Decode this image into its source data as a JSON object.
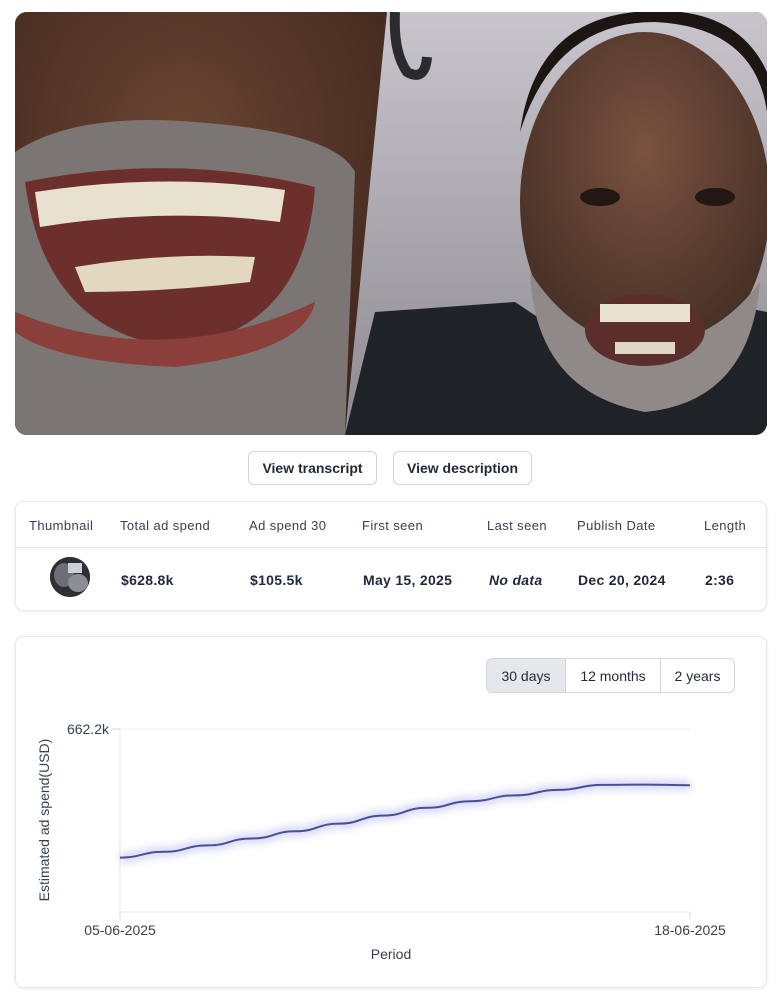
{
  "video": {
    "description_icon": "video-player"
  },
  "buttons": {
    "transcript": "View transcript",
    "description": "View description"
  },
  "stats": {
    "headers": [
      "Thumbnail",
      "Total ad spend",
      "Ad spend 30",
      "First seen",
      "Last seen",
      "Publish Date",
      "Length"
    ],
    "values": {
      "total_ad_spend": "$628.8k",
      "ad_spend_30": "$105.5k",
      "first_seen": "May 15, 2025",
      "last_seen": "No data",
      "publish_date": "Dec 20, 2024",
      "length": "2:36"
    }
  },
  "range": {
    "options": [
      "30 days",
      "12 months",
      "2 years"
    ],
    "selected": "30 days"
  },
  "chart_data": {
    "type": "line",
    "xlabel": "Period",
    "ylabel": "Estimated ad spend(USD)",
    "x_ticks": [
      "05-06-2025",
      "18-06-2025"
    ],
    "y_ticks": [
      "662.2k"
    ],
    "ylim": [
      0,
      662200
    ],
    "x": [
      "05-06-2025",
      "06-06-2025",
      "07-06-2025",
      "08-06-2025",
      "09-06-2025",
      "10-06-2025",
      "11-06-2025",
      "12-06-2025",
      "13-06-2025",
      "14-06-2025",
      "15-06-2025",
      "16-06-2025",
      "17-06-2025",
      "18-06-2025"
    ],
    "series": [
      {
        "color": "#4b4e96",
        "values": [
          197000,
          218000,
          241000,
          266000,
          292000,
          320000,
          349000,
          377000,
          401000,
          422000,
          442000,
          460000,
          461000,
          459000
        ]
      }
    ],
    "grid": false
  }
}
